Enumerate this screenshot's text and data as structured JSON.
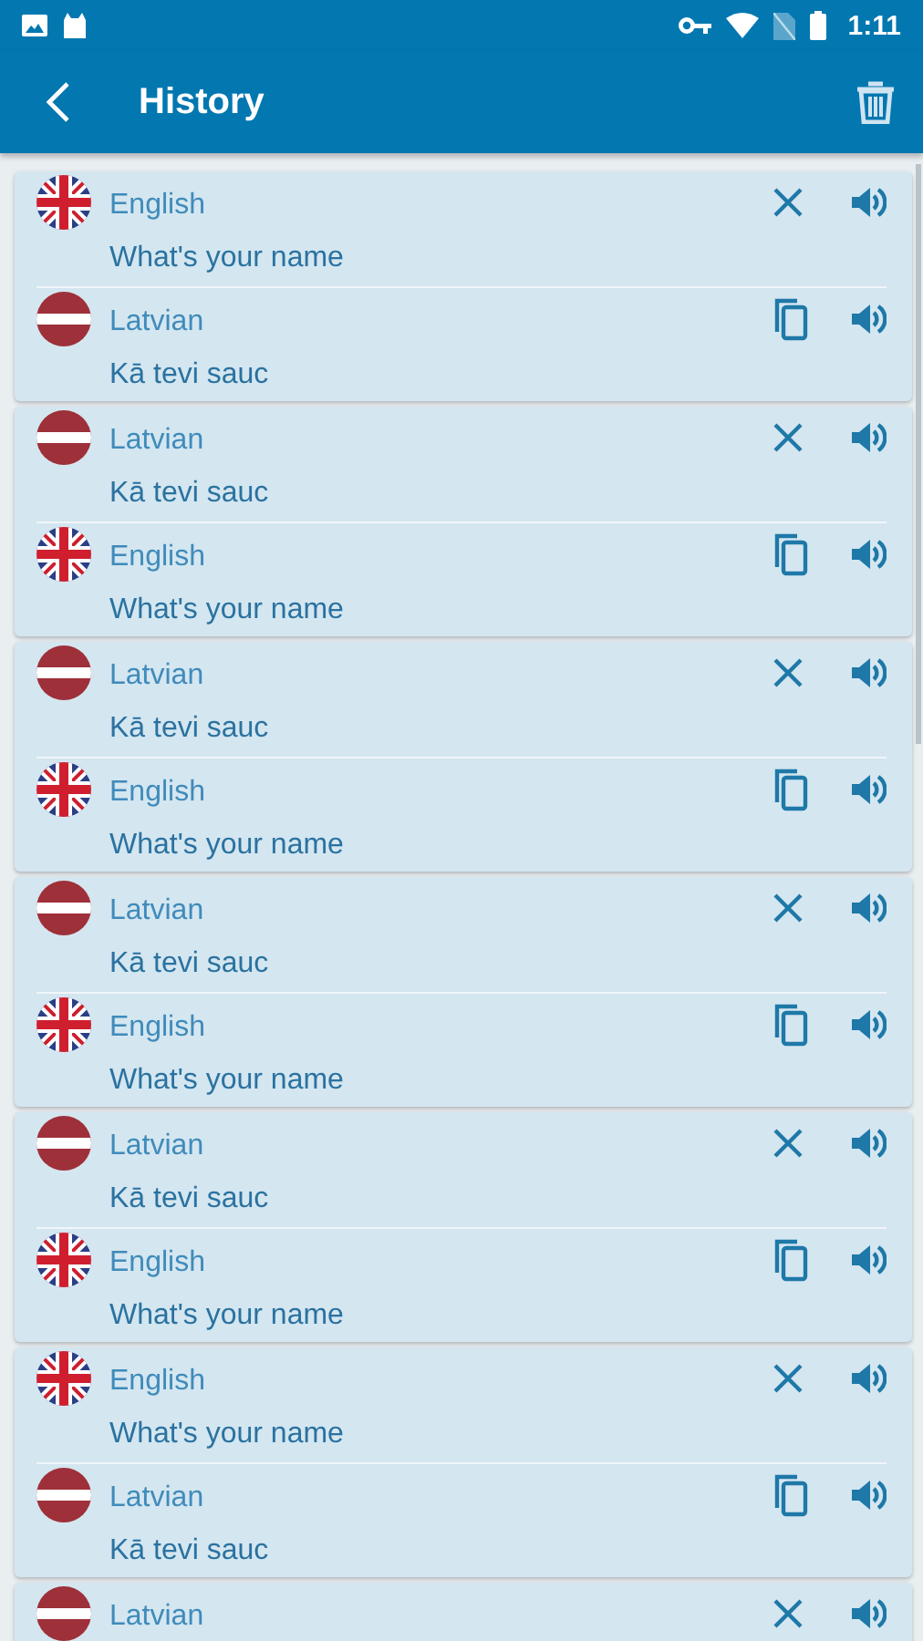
{
  "status_bar": {
    "time": "1:11"
  },
  "toolbar": {
    "title": "History"
  },
  "history": [
    {
      "source": {
        "kind": "uk",
        "language": "English",
        "text": "What's your name"
      },
      "target": {
        "kind": "lv",
        "language": "Latvian",
        "text": "Kā tevi sauc"
      }
    },
    {
      "source": {
        "kind": "lv",
        "language": "Latvian",
        "text": "Kā tevi sauc"
      },
      "target": {
        "kind": "uk",
        "language": "English",
        "text": "What's your name"
      }
    },
    {
      "source": {
        "kind": "lv",
        "language": "Latvian",
        "text": "Kā tevi sauc"
      },
      "target": {
        "kind": "uk",
        "language": "English",
        "text": "What's your name"
      }
    },
    {
      "source": {
        "kind": "lv",
        "language": "Latvian",
        "text": "Kā tevi sauc"
      },
      "target": {
        "kind": "uk",
        "language": "English",
        "text": "What's your name"
      }
    },
    {
      "source": {
        "kind": "lv",
        "language": "Latvian",
        "text": "Kā tevi sauc"
      },
      "target": {
        "kind": "uk",
        "language": "English",
        "text": "What's your name"
      }
    },
    {
      "source": {
        "kind": "uk",
        "language": "English",
        "text": "What's your name"
      },
      "target": {
        "kind": "lv",
        "language": "Latvian",
        "text": "Kā tevi sauc"
      }
    },
    {
      "source": {
        "kind": "lv",
        "language": "Latvian"
      }
    }
  ]
}
